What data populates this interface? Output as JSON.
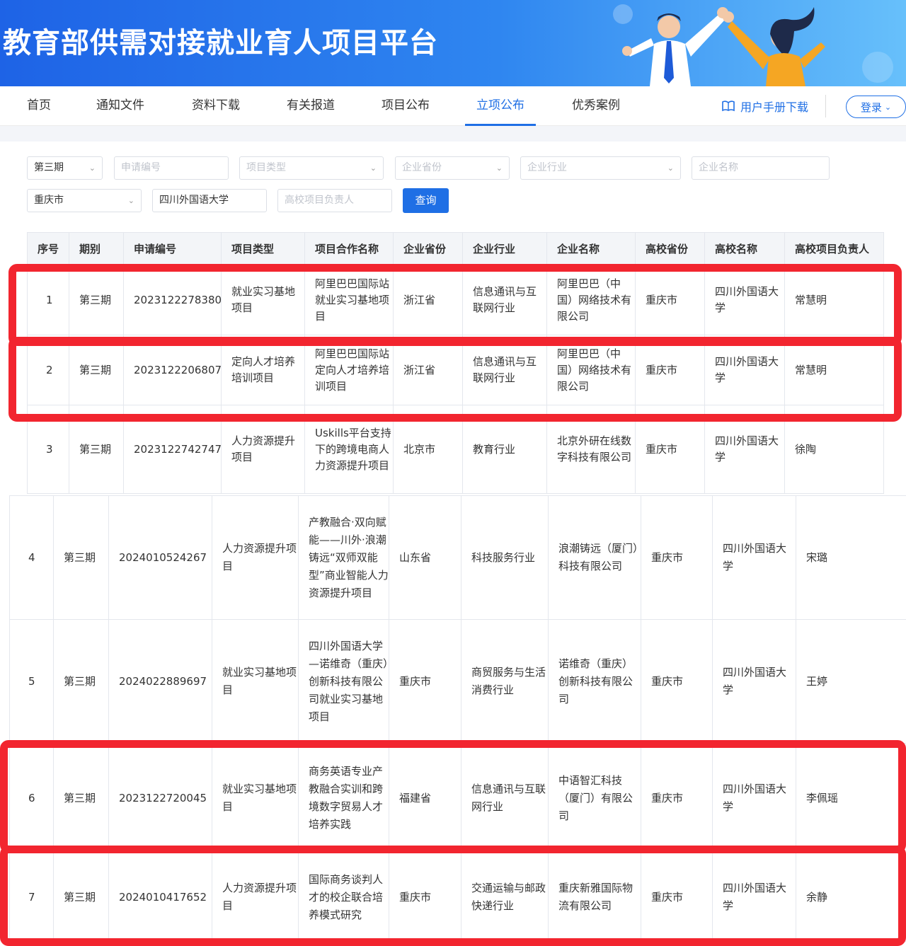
{
  "banner": {
    "title": "教育部供需对接就业育人项目平台"
  },
  "nav": {
    "items": [
      "首页",
      "通知文件",
      "资料下载",
      "有关报道",
      "项目公布",
      "立项公布",
      "优秀案例"
    ],
    "active_index": 5,
    "manual_label": "用户手册下载",
    "login_label": "登录"
  },
  "filters": {
    "period": "第三期",
    "application_no_placeholder": "申请编号",
    "project_type_placeholder": "项目类型",
    "company_province_placeholder": "企业省份",
    "company_industry_placeholder": "企业行业",
    "company_name_placeholder": "企业名称",
    "university_province": "重庆市",
    "university_name": "四川外国语大学",
    "university_leader_placeholder": "高校项目负责人",
    "query_label": "查询"
  },
  "table": {
    "headers": [
      "序号",
      "期别",
      "申请编号",
      "项目类型",
      "项目合作名称",
      "企业省份",
      "企业行业",
      "企业名称",
      "高校省份",
      "高校名称",
      "高校项目负责人"
    ],
    "rows": [
      [
        "1",
        "第三期",
        "2023122278380",
        "就业实习基地项目",
        "阿里巴巴国际站就业实习基地项目",
        "浙江省",
        "信息通讯与互联网行业",
        "阿里巴巴（中国）网络技术有限公司",
        "重庆市",
        "四川外国语大学",
        "常慧明"
      ],
      [
        "2",
        "第三期",
        "2023122206807",
        "定向人才培养培训项目",
        "阿里巴巴国际站定向人才培养培训项目",
        "浙江省",
        "信息通讯与互联网行业",
        "阿里巴巴（中国）网络技术有限公司",
        "重庆市",
        "四川外国语大学",
        "常慧明"
      ],
      [
        "3",
        "第三期",
        "2023122742747",
        "人力资源提升项目",
        "Uskills平台支持下的跨境电商人力资源提升项目",
        "北京市",
        "教育行业",
        "北京外研在线数字科技有限公司",
        "重庆市",
        "四川外国语大学",
        "徐陶"
      ],
      [
        "4",
        "第三期",
        "2024010524267",
        "人力资源提升项目",
        "产教融合·双向赋能——川外·浪潮铸远“双师双能型”商业智能人力资源提升项目",
        "山东省",
        "科技服务行业",
        "浪潮铸远（厦门）科技有限公司",
        "重庆市",
        "四川外国语大学",
        "宋璐"
      ],
      [
        "5",
        "第三期",
        "2024022889697",
        "就业实习基地项目",
        "四川外国语大学—诺维奇（重庆）创新科技有限公司就业实习基地项目",
        "重庆市",
        "商贸服务与生活消费行业",
        "诺维奇（重庆）创新科技有限公司",
        "重庆市",
        "四川外国语大学",
        "王婷"
      ],
      [
        "6",
        "第三期",
        "2023122720045",
        "就业实习基地项目",
        "商务英语专业产教融合实训和跨境数字贸易人才培养实践",
        "福建省",
        "信息通讯与互联网行业",
        "中语智汇科技（厦门）有限公司",
        "重庆市",
        "四川外国语大学",
        "李佩瑶"
      ],
      [
        "7",
        "第三期",
        "2024010417652",
        "人力资源提升项目",
        "国际商务谈判人才的校企联合培养模式研究",
        "重庆市",
        "交通运输与邮政快递行业",
        "重庆新雅国际物流有限公司",
        "重庆市",
        "四川外国语大学",
        "余静"
      ]
    ]
  },
  "highlight_color": "#f2252f",
  "accent_color": "#1f6fe5"
}
